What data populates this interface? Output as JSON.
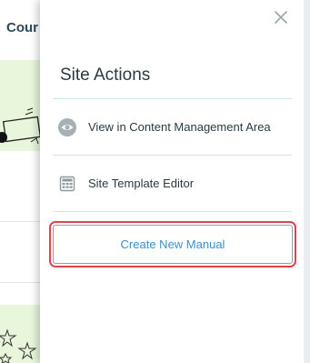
{
  "background": {
    "title_fragment": "Cour"
  },
  "panel": {
    "title": "Site Actions",
    "items": [
      {
        "label": "View in Content Management Area",
        "icon": "eye-icon"
      },
      {
        "label": "Site Template Editor",
        "icon": "template-grid-icon"
      }
    ],
    "primary_action": {
      "label": "Create New Manual"
    },
    "close_icon": "close-icon",
    "highlight_color": "#e0424a",
    "accent_color": "#3a90c8"
  }
}
